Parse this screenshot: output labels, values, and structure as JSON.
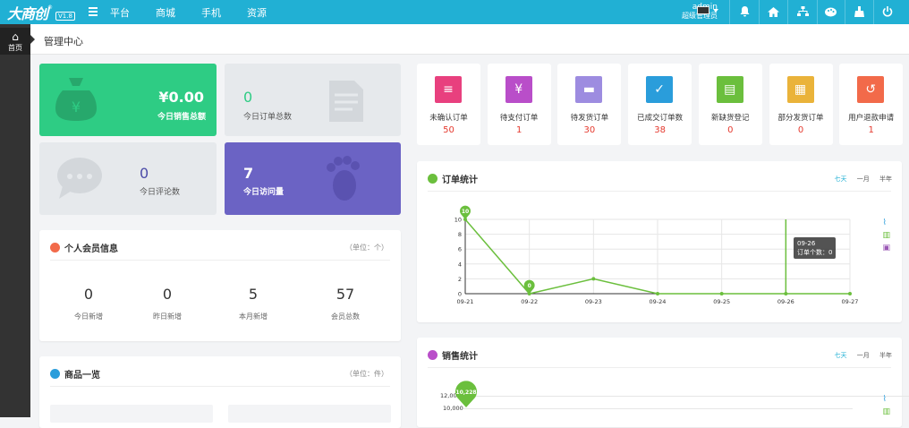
{
  "topbar": {
    "logo": "大商创",
    "logo_reg": "®",
    "version": "V1.8",
    "nav": [
      "平台",
      "商城",
      "手机",
      "资源"
    ],
    "user_name": "admin",
    "user_role": "超级管理员"
  },
  "sidebar": {
    "home_label": "首页"
  },
  "page": {
    "title": "管理中心"
  },
  "stats": {
    "sales_value": "¥0.00",
    "sales_label": "今日销售总额",
    "orders_value": "0",
    "orders_label": "今日订单总数",
    "reviews_value": "0",
    "reviews_label": "今日评论数",
    "visits_value": "7",
    "visits_label": "今日访问量"
  },
  "members": {
    "title": "个人会员信息",
    "unit": "（单位：个）",
    "items": [
      {
        "value": "0",
        "label": "今日新增"
      },
      {
        "value": "0",
        "label": "昨日新增"
      },
      {
        "value": "5",
        "label": "本月新增"
      },
      {
        "value": "57",
        "label": "会员总数"
      }
    ]
  },
  "goods": {
    "title": "商品一览",
    "unit": "（单位：件）"
  },
  "order_status": [
    {
      "label": "未确认订单",
      "value": "50",
      "icon": "document-icon",
      "color": "#e8407e"
    },
    {
      "label": "待支付订单",
      "value": "1",
      "icon": "money-bag-icon",
      "color": "#b94ec9"
    },
    {
      "label": "待发货订单",
      "value": "30",
      "icon": "truck-icon",
      "color": "#9d8ce0"
    },
    {
      "label": "已成交订单数",
      "value": "38",
      "icon": "clipboard-check-icon",
      "color": "#2a9ddb"
    },
    {
      "label": "新缺货登记",
      "value": "0",
      "icon": "notebook-icon",
      "color": "#6bbf3d"
    },
    {
      "label": "部分发货订单",
      "value": "0",
      "icon": "cart-icon",
      "color": "#eab33a"
    },
    {
      "label": "用户退款申请",
      "value": "1",
      "icon": "refund-icon",
      "color": "#f26a4a"
    }
  ],
  "order_chart": {
    "title": "订单统计",
    "ranges": [
      "七天",
      "一月",
      "半年"
    ],
    "tooltip_date": "09-26",
    "tooltip_text": "订单个数：0"
  },
  "sales_chart": {
    "title": "销售统计",
    "ranges": [
      "七天",
      "一月",
      "半年"
    ],
    "peak_label": "10,228",
    "y_ticks": [
      "12,000",
      "10,000"
    ]
  },
  "chart_data": {
    "type": "line",
    "title": "订单统计",
    "categories": [
      "09-21",
      "09-22",
      "09-23",
      "09-24",
      "09-25",
      "09-26",
      "09-27"
    ],
    "values": [
      10,
      0,
      2,
      0,
      0,
      0,
      0
    ],
    "y_ticks": [
      0,
      2,
      4,
      6,
      8,
      10
    ],
    "ylim": [
      0,
      10
    ],
    "marked_labels": [
      "10",
      "0"
    ],
    "series_color": "#6bbf3d",
    "grid": true
  },
  "colors": {
    "topbar": "#21b0d4",
    "sales_card": "#2ecc84",
    "visits_card": "#6b63c4",
    "accent_red": "#e53a2f"
  }
}
